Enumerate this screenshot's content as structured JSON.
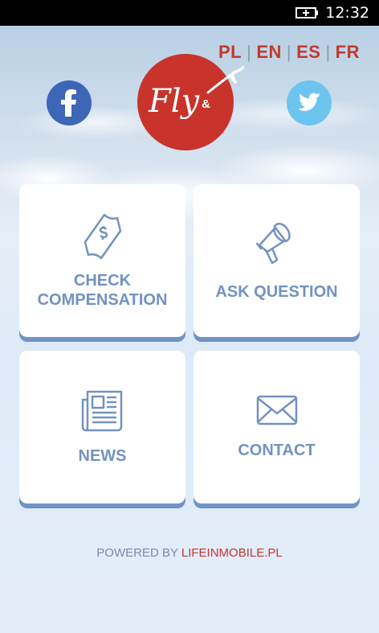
{
  "status_bar": {
    "time": "12:32",
    "battery_icon": "battery-charging-icon"
  },
  "languages": [
    "PL",
    "EN",
    "ES",
    "FR"
  ],
  "logo": {
    "text": "Fly",
    "ampersand": "&"
  },
  "social": {
    "facebook_icon": "facebook-icon",
    "twitter_icon": "twitter-icon"
  },
  "tiles": [
    {
      "label": "CHECK\nCOMPENSATION",
      "icon": "money-ticket-icon"
    },
    {
      "label": "ASK QUESTION",
      "icon": "megaphone-icon"
    },
    {
      "label": "NEWS",
      "icon": "newspaper-icon"
    },
    {
      "label": "CONTACT",
      "icon": "envelope-icon"
    }
  ],
  "footer": {
    "prefix": "POWERED BY ",
    "brand": "LIFEINMOBILE.PL"
  },
  "colors": {
    "accent_red": "#c8332c",
    "tile_text": "#7392c1",
    "facebook": "#3e66b6",
    "twitter": "#6cc4ef"
  }
}
